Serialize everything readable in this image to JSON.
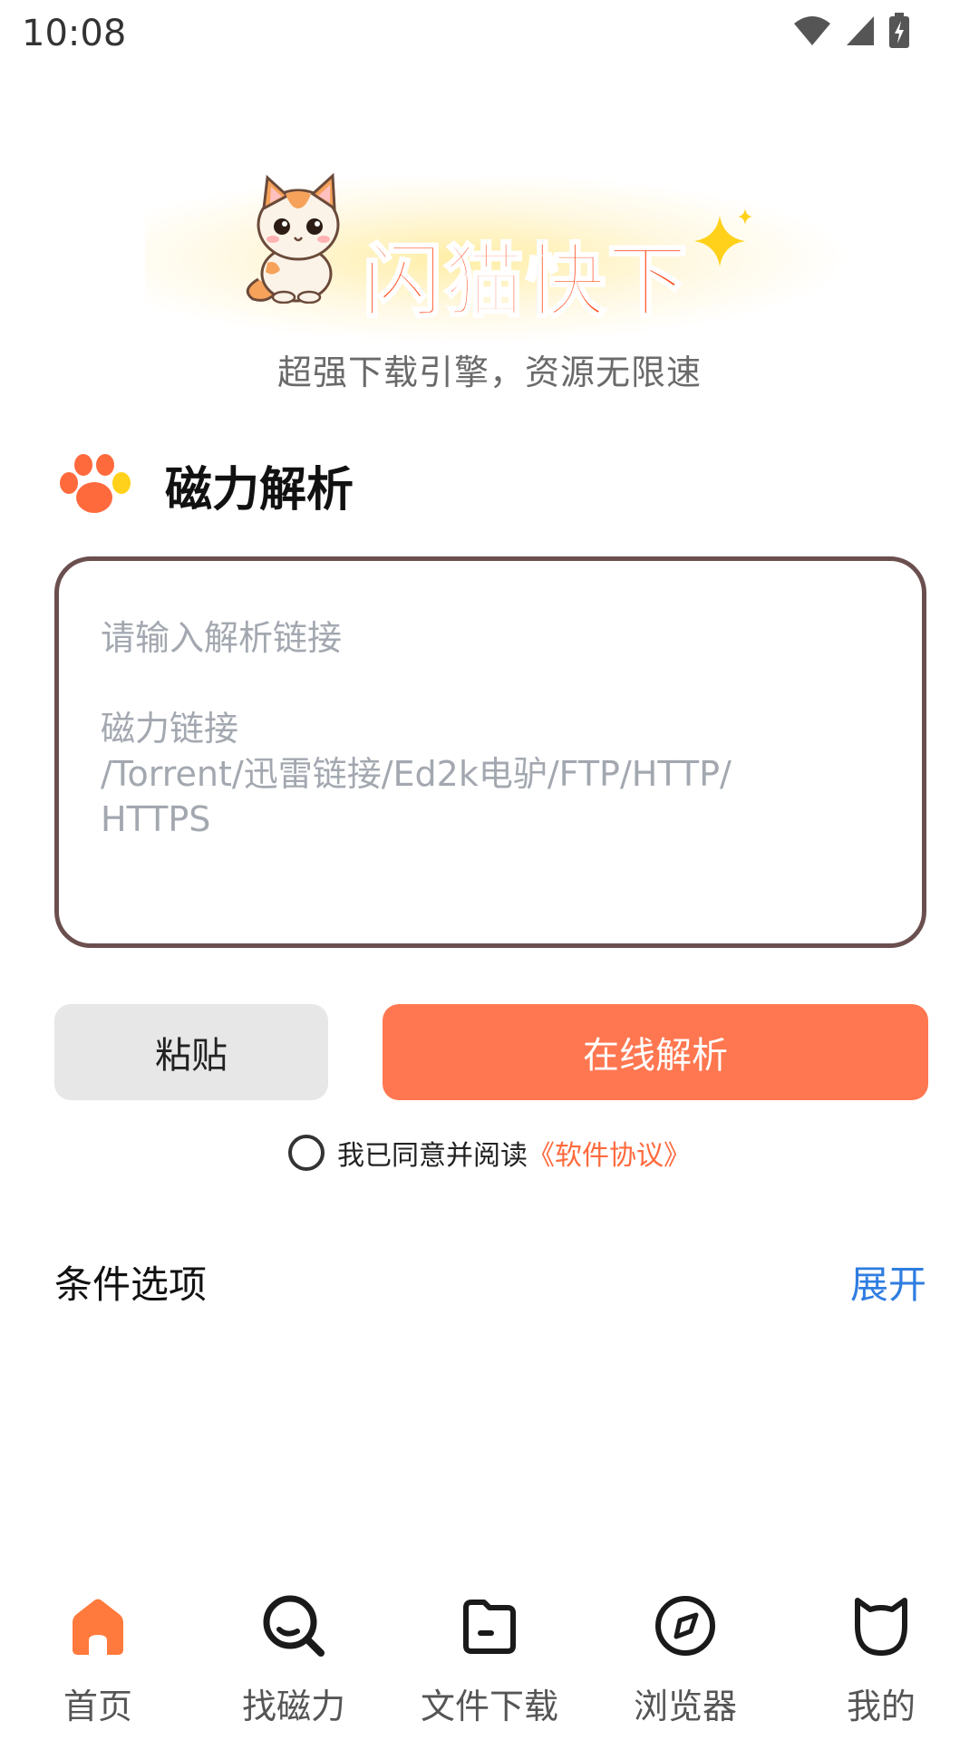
{
  "status_bar": {
    "time": "10:08"
  },
  "brand": {
    "title": "闪猫快下",
    "tagline": "超强下载引擎，资源无限速"
  },
  "section": {
    "title": "磁力解析"
  },
  "link_input": {
    "placeholder": "请输入解析链接\n\n磁力链接\n/Torrent/迅雷链接/Ed2k电驴/FTP/HTTP/\nHTTPS",
    "value": ""
  },
  "buttons": {
    "paste": "粘贴",
    "parse": "在线解析"
  },
  "agreement": {
    "text": "我已同意并阅读",
    "link": "《软件协议》",
    "checked": false
  },
  "conditions": {
    "label": "条件选项",
    "expand": "展开"
  },
  "bottom_nav": {
    "items": [
      {
        "label": "首页",
        "icon": "home-icon",
        "active": true
      },
      {
        "label": "找磁力",
        "icon": "search-icon",
        "active": false
      },
      {
        "label": "文件下载",
        "icon": "folder-icon",
        "active": false
      },
      {
        "label": "浏览器",
        "icon": "compass-icon",
        "active": false
      },
      {
        "label": "我的",
        "icon": "cat-face-icon",
        "active": false
      }
    ]
  },
  "colors": {
    "accent": "#ff7750",
    "brand_red": "#ff4a1a",
    "link_blue": "#2f7de1",
    "input_border": "#6b4f4f"
  }
}
